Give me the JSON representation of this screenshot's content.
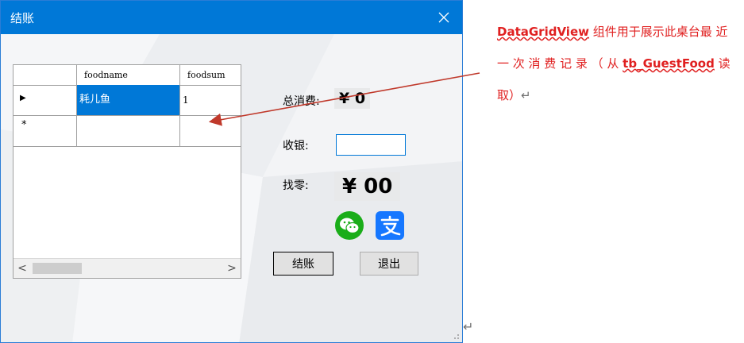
{
  "window": {
    "title": "结账"
  },
  "grid": {
    "columns": [
      "foodname",
      "foodsum"
    ],
    "rows": [
      {
        "foodname": "耗儿鱼",
        "foodsum": "1"
      }
    ],
    "current_row_marker": "▶",
    "new_row_marker": "*",
    "scroll_left": "<",
    "scroll_right": ">"
  },
  "form": {
    "total_label": "总消费:",
    "total_value": "¥ 0",
    "cash_label": "收银:",
    "cash_value": "",
    "change_label": "找零:",
    "change_value": "¥ 00",
    "checkout_button": "结账",
    "exit_button": "退出"
  },
  "annotation": {
    "part1": "DataGridView",
    "part2": " 组件用于展示此桌台最 近 一 次 消 费 记 录 （ 从 ",
    "part3": "tb_GuestFood",
    "part4": " 读取）",
    "return_mark": "↵"
  },
  "colors": {
    "titlebar": "#0078d7",
    "selection": "#0078d7",
    "annotation": "#e02020",
    "wechat": "#1aad19",
    "alipay": "#1677ff"
  },
  "icons": [
    "close-icon",
    "wechat-icon",
    "alipay-icon"
  ]
}
